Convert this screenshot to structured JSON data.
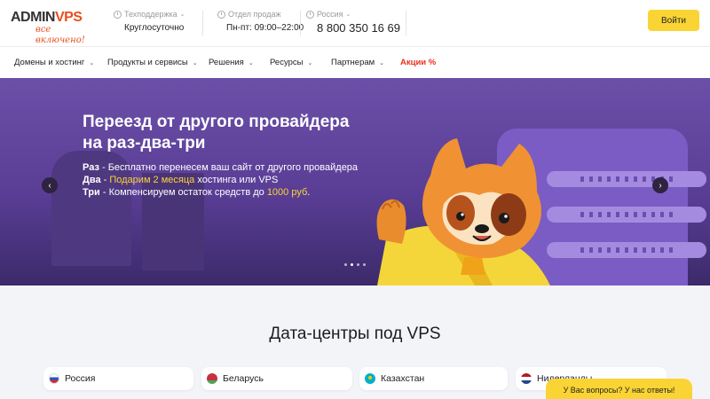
{
  "header": {
    "logo": {
      "main_a": "ADMIN",
      "main_b": "VPS",
      "tagline": "все включено!"
    },
    "support": {
      "label": "Техподдержка",
      "value": "Круглосуточно"
    },
    "sales": {
      "label": "Отдел продаж",
      "value": "Пн-пт: 09:00–22:00"
    },
    "region": {
      "label": "Россия",
      "phone": "8 800 350 16 69"
    },
    "login_label": "Войти"
  },
  "nav": {
    "items": [
      {
        "label": "Домены и хостинг"
      },
      {
        "label": "Продукты и сервисы"
      },
      {
        "label": "Решения"
      },
      {
        "label": "Ресурсы"
      },
      {
        "label": "Партнерам"
      }
    ],
    "promo": "Акции %"
  },
  "hero": {
    "title": "Переезд от другого провайдера на раз-два-три",
    "line1": {
      "lead": "Раз",
      "text": " - Бесплатно перенесем ваш сайт от другого провайдера"
    },
    "line2": {
      "lead": "Два",
      "dash": " - ",
      "highlight": "Подарим 2 месяца",
      "text": " хостинга или VPS"
    },
    "line3": {
      "lead": "Три",
      "text": " - Компенсируем остаток средств до ",
      "highlight": "1000 руб",
      "end": "."
    },
    "slides_count": 4,
    "active_slide": 1
  },
  "datacenters": {
    "title": "Дата-центры под VPS",
    "cards": [
      {
        "label": "Россия",
        "flag": "ru-flag-icon"
      },
      {
        "label": "Беларусь",
        "flag": "by-flag-icon"
      },
      {
        "label": "Казахстан",
        "flag": "kz-flag-icon"
      },
      {
        "label": "Нидерланды",
        "flag": "nl-flag-icon"
      }
    ]
  },
  "chat": {
    "label": "У Вас вопросы? У нас ответы!"
  },
  "colors": {
    "accent": "#fad434",
    "brand": "#e8501d",
    "hero_bg": "#5a3e96",
    "promo": "#e8301d"
  }
}
